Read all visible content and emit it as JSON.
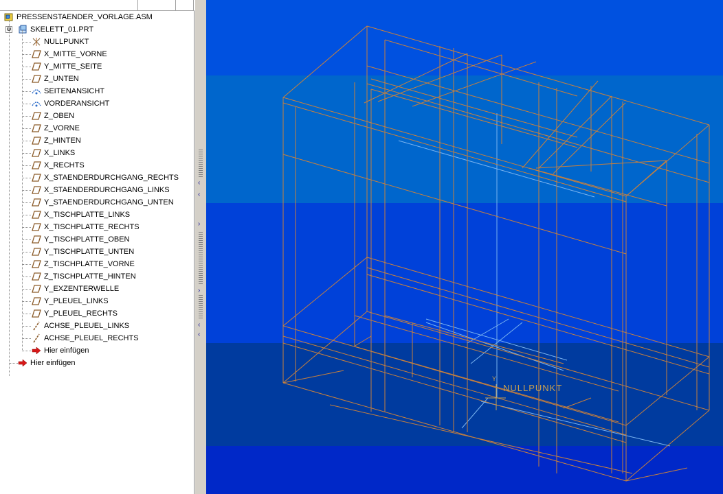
{
  "model_tree": {
    "root": {
      "label": "PRESSENSTAENDER_VORLAGE.ASM",
      "icon": "assembly-icon"
    },
    "part": {
      "label": "SKELETT_01.PRT",
      "icon": "part-icon",
      "expander": "⊖"
    },
    "features": [
      {
        "label": "NULLPUNKT",
        "icon": "coordinate-system-icon"
      },
      {
        "label": "X_MITTE_VORNE",
        "icon": "datum-plane-icon"
      },
      {
        "label": "Y_MITTE_SEITE",
        "icon": "datum-plane-icon"
      },
      {
        "label": "Z_UNTEN",
        "icon": "datum-plane-icon"
      },
      {
        "label": "SEITENANSICHT",
        "icon": "view-icon"
      },
      {
        "label": "VORDERANSICHT",
        "icon": "view-icon"
      },
      {
        "label": "Z_OBEN",
        "icon": "datum-plane-icon"
      },
      {
        "label": "Z_VORNE",
        "icon": "datum-plane-icon"
      },
      {
        "label": "Z_HINTEN",
        "icon": "datum-plane-icon"
      },
      {
        "label": "X_LINKS",
        "icon": "datum-plane-icon"
      },
      {
        "label": "X_RECHTS",
        "icon": "datum-plane-icon"
      },
      {
        "label": "X_STAENDERDURCHGANG_RECHTS",
        "icon": "datum-plane-icon"
      },
      {
        "label": "X_STAENDERDURCHGANG_LINKS",
        "icon": "datum-plane-icon"
      },
      {
        "label": "Y_STAENDERDURCHGANG_UNTEN",
        "icon": "datum-plane-icon"
      },
      {
        "label": "X_TISCHPLATTE_LINKS",
        "icon": "datum-plane-icon"
      },
      {
        "label": "X_TISCHPLATTE_RECHTS",
        "icon": "datum-plane-icon"
      },
      {
        "label": "Y_TISCHPLATTE_OBEN",
        "icon": "datum-plane-icon"
      },
      {
        "label": "Y_TISCHPLATTE_UNTEN",
        "icon": "datum-plane-icon"
      },
      {
        "label": "Z_TISCHPLATTE_VORNE",
        "icon": "datum-plane-icon"
      },
      {
        "label": "Z_TISCHPLATTE_HINTEN",
        "icon": "datum-plane-icon"
      },
      {
        "label": "Y_EXZENTERWELLE",
        "icon": "datum-plane-icon"
      },
      {
        "label": "Y_PLEUEL_LINKS",
        "icon": "datum-plane-icon"
      },
      {
        "label": "Y_PLEUEL_RECHTS",
        "icon": "datum-plane-icon"
      },
      {
        "label": "ACHSE_PLEUEL_LINKS",
        "icon": "datum-axis-icon"
      },
      {
        "label": "ACHSE_PLEUEL_RECHTS",
        "icon": "datum-axis-icon"
      }
    ],
    "insert_here_part": {
      "label": "Hier einfügen",
      "icon": "insert-arrow-icon"
    },
    "insert_here_asm": {
      "label": "Hier einfügen",
      "icon": "insert-arrow-icon"
    }
  },
  "splitter": {
    "arrow_left": "‹",
    "arrow_right": "›"
  },
  "viewport": {
    "csys_label": "NULLPUNKT",
    "csys_axis_y": "Y",
    "colors": {
      "background_bands": [
        "#0051e0",
        "#0066cc",
        "#0041d9",
        "#003b9f",
        "#0028c8"
      ],
      "wireframe": "#c8803c",
      "datum": "#7ab4f0",
      "csys_label": "#c8a050"
    }
  }
}
